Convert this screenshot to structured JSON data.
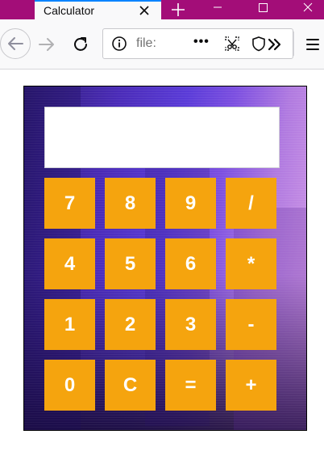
{
  "browser": {
    "tab": {
      "title": "Calculator"
    },
    "url": {
      "text": "file:"
    },
    "page_actions_label": "•••"
  },
  "calculator": {
    "display_value": "",
    "keys": [
      "7",
      "8",
      "9",
      "/",
      "4",
      "5",
      "6",
      "*",
      "1",
      "2",
      "3",
      "-",
      "0",
      "C",
      "=",
      "+"
    ]
  },
  "colors": {
    "tabstrip": "#a30d78",
    "key": "#f5a40e",
    "key_text": "#ffffff",
    "display": "#ffffff"
  }
}
